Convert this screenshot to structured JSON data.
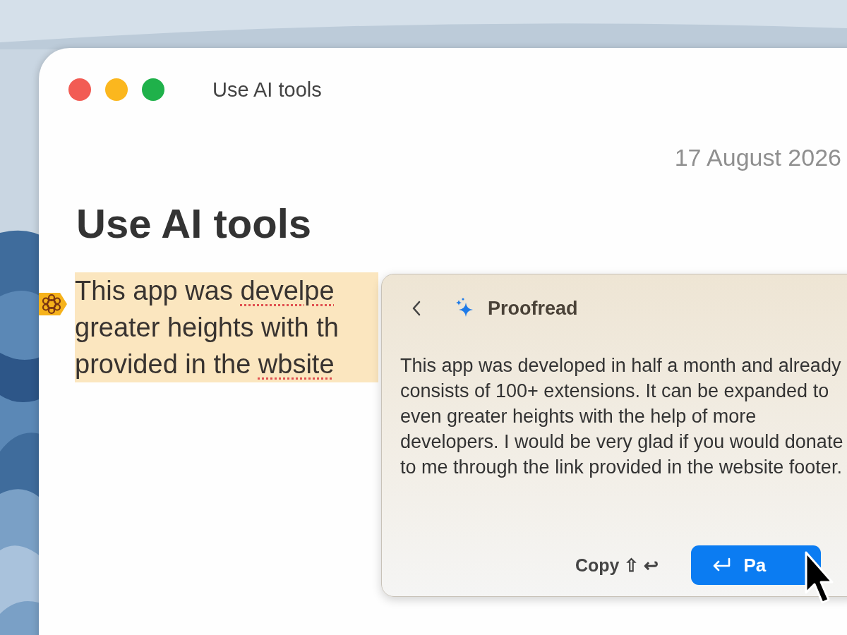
{
  "window": {
    "title": "Use AI tools"
  },
  "note": {
    "date": "17 August 2026",
    "heading": "Use AI tools",
    "highlighted": true,
    "lines": [
      {
        "segments": [
          {
            "text": "This app was ",
            "misspelled": false
          },
          {
            "text": "develpe",
            "misspelled": true
          }
        ]
      },
      {
        "segments": [
          {
            "text": "greater heights with th",
            "misspelled": false
          }
        ]
      },
      {
        "segments": [
          {
            "text": "provided in the ",
            "misspelled": false
          },
          {
            "text": "wbsite",
            "misspelled": true
          }
        ]
      }
    ]
  },
  "popup": {
    "title": "Proofread",
    "text": "This app was developed in half a month and already consists of 100+ extensions. It can be expanded to even greater heights with the help of more developers. I would be very glad if you would donate to me through the link provided in the website footer.",
    "copy_label": "Copy",
    "shortcut": "⇧ ↩",
    "paste_label": "Pa"
  }
}
